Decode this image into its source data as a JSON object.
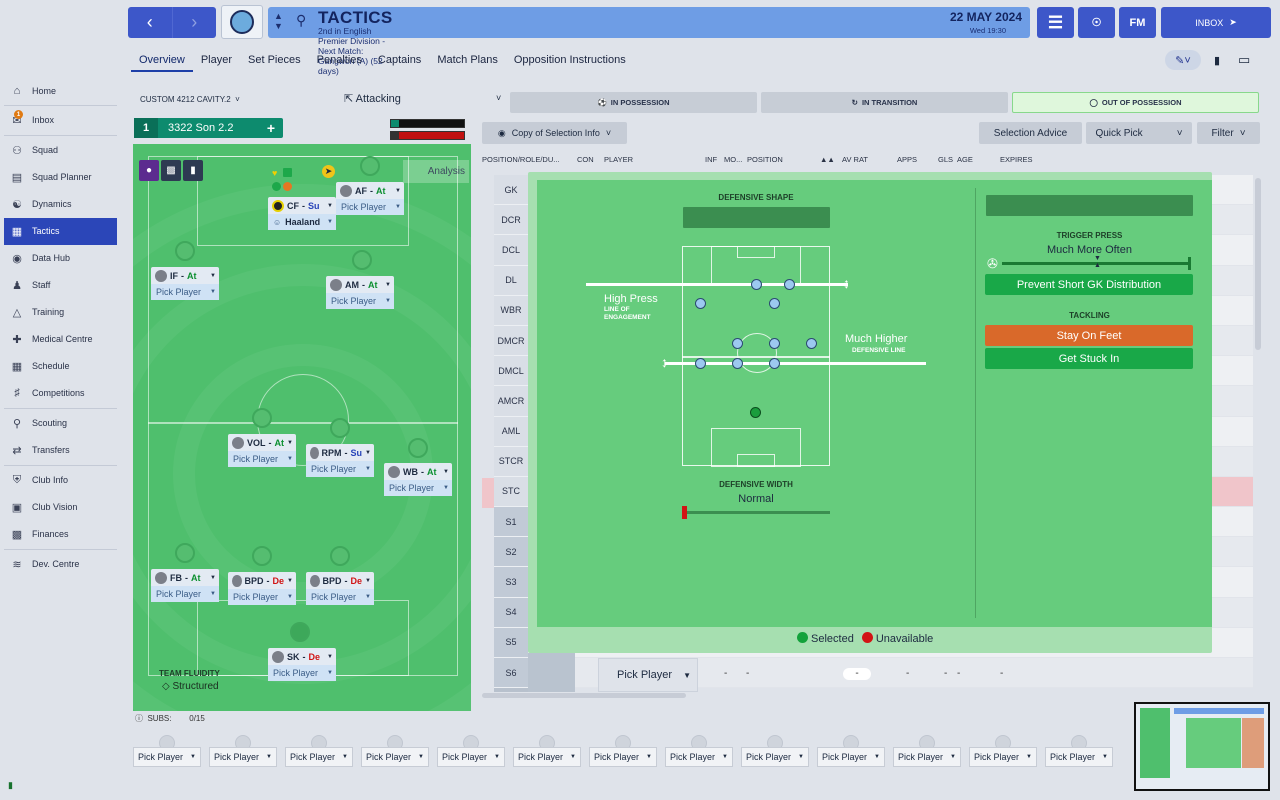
{
  "topbar": {
    "back_icon": "arrow-left-icon",
    "forward_icon": "arrow-right-icon",
    "title": "TACTICS",
    "subtitle": "2nd in English Premier Division - Next Match: Gangwon (A) (52 days)",
    "date": "22 MAY 2024",
    "time": "Wed 19:30",
    "fm_label": "FM",
    "inbox_label": "INBOX"
  },
  "subtabs": [
    "Overview",
    "Player",
    "Set Pieces",
    "Penalties",
    "Captains",
    "Match Plans",
    "Opposition Instructions"
  ],
  "sidebar": {
    "items": [
      {
        "label": "Home",
        "icon": "home-icon"
      },
      {
        "label": "Inbox",
        "icon": "inbox-icon",
        "badge": "1"
      },
      {
        "label": "Squad",
        "icon": "squad-icon"
      },
      {
        "label": "Squad Planner",
        "icon": "clipboard-icon"
      },
      {
        "label": "Dynamics",
        "icon": "dynamics-icon"
      },
      {
        "label": "Tactics",
        "icon": "tactics-icon"
      },
      {
        "label": "Data Hub",
        "icon": "globe-icon"
      },
      {
        "label": "Staff",
        "icon": "staff-icon"
      },
      {
        "label": "Training",
        "icon": "training-icon"
      },
      {
        "label": "Medical Centre",
        "icon": "medical-icon"
      },
      {
        "label": "Schedule",
        "icon": "calendar-icon"
      },
      {
        "label": "Competitions",
        "icon": "trophy-icon"
      },
      {
        "label": "Scouting",
        "icon": "scouting-icon"
      },
      {
        "label": "Transfers",
        "icon": "transfers-icon"
      },
      {
        "label": "Club Info",
        "icon": "shield-icon"
      },
      {
        "label": "Club Vision",
        "icon": "vision-icon"
      },
      {
        "label": "Finances",
        "icon": "finances-icon"
      },
      {
        "label": "Dev. Centre",
        "icon": "dev-icon"
      }
    ]
  },
  "tactic": {
    "name": "CUSTOM 4212 CAVITY.2",
    "mentality": "Attacking",
    "slot": "1",
    "formation_name": "3322 Son 2.2"
  },
  "pitch": {
    "analysis": "Analysis",
    "fluidity_label": "TEAM FLUIDITY",
    "fluidity_value": "Structured",
    "positions": [
      {
        "role": "CF",
        "duty": "Su",
        "player": "Haaland"
      },
      {
        "role": "AF",
        "duty": "At",
        "player": "Pick Player"
      },
      {
        "role": "IF",
        "duty": "At",
        "player": "Pick Player"
      },
      {
        "role": "AM",
        "duty": "At",
        "player": "Pick Player"
      },
      {
        "role": "VOL",
        "duty": "At",
        "player": "Pick Player"
      },
      {
        "role": "RPM",
        "duty": "Su",
        "player": "Pick Player"
      },
      {
        "role": "WB",
        "duty": "At",
        "player": "Pick Player"
      },
      {
        "role": "FB",
        "duty": "At",
        "player": "Pick Player"
      },
      {
        "role": "BPD",
        "duty": "De",
        "player": "Pick Player"
      },
      {
        "role": "BPD",
        "duty": "De",
        "player": "Pick Player"
      },
      {
        "role": "SK",
        "duty": "De",
        "player": "Pick Player"
      }
    ]
  },
  "subs": {
    "label": "SUBS:",
    "count": "0/15",
    "slots": [
      "Pick Player",
      "Pick Player",
      "Pick Player",
      "Pick Player",
      "Pick Player",
      "Pick Player",
      "Pick Player",
      "Pick Player",
      "Pick Player",
      "Pick Player",
      "Pick Player",
      "Pick Player",
      "Pick Player"
    ]
  },
  "phases": [
    {
      "label": "IN POSSESSION",
      "active": false
    },
    {
      "label": "IN TRANSITION",
      "active": false
    },
    {
      "label": "OUT OF POSSESSION",
      "active": true
    }
  ],
  "toolbar": {
    "copy": "Copy of Selection Info",
    "advice": "Selection Advice",
    "quick_pick": "Quick Pick",
    "filter": "Filter"
  },
  "columns": [
    "POSITION/ROLE/DU...",
    "CON",
    "PLAYER",
    "INF",
    "MO...",
    "POSITION",
    "AV RAT",
    "APPS",
    "GLS",
    "AGE",
    "EXPIRES"
  ],
  "position_rows": [
    "GK",
    "DCR",
    "DCL",
    "DL",
    "WBR",
    "DMCR",
    "DMCL",
    "AMCR",
    "AML",
    "STCR",
    "STC",
    "S1",
    "S2",
    "S3",
    "S4",
    "S5",
    "S6"
  ],
  "oop": {
    "defensive_shape_label": "DEFENSIVE SHAPE",
    "engagement_value": "High Press",
    "engagement_label": "LINE OF ENGAGEMENT",
    "defline_value": "Much Higher",
    "defline_label": "DEFENSIVE LINE",
    "width_label": "DEFENSIVE WIDTH",
    "width_value": "Normal",
    "trigger_label": "TRIGGER PRESS",
    "trigger_value": "Much More Often",
    "prevent_gk": "Prevent Short GK Distribution",
    "tackling_label": "TACKLING",
    "stay_on_feet": "Stay On Feet",
    "get_stuck_in": "Get Stuck In",
    "selected": "Selected",
    "unavailable": "Unavailable",
    "colors": {
      "selected": "#13a23b",
      "unavailable": "#d21414",
      "stay": "#d9692a",
      "green": "#19a848"
    }
  },
  "pick_row": {
    "label": "Pick Player",
    "dash": "-"
  }
}
